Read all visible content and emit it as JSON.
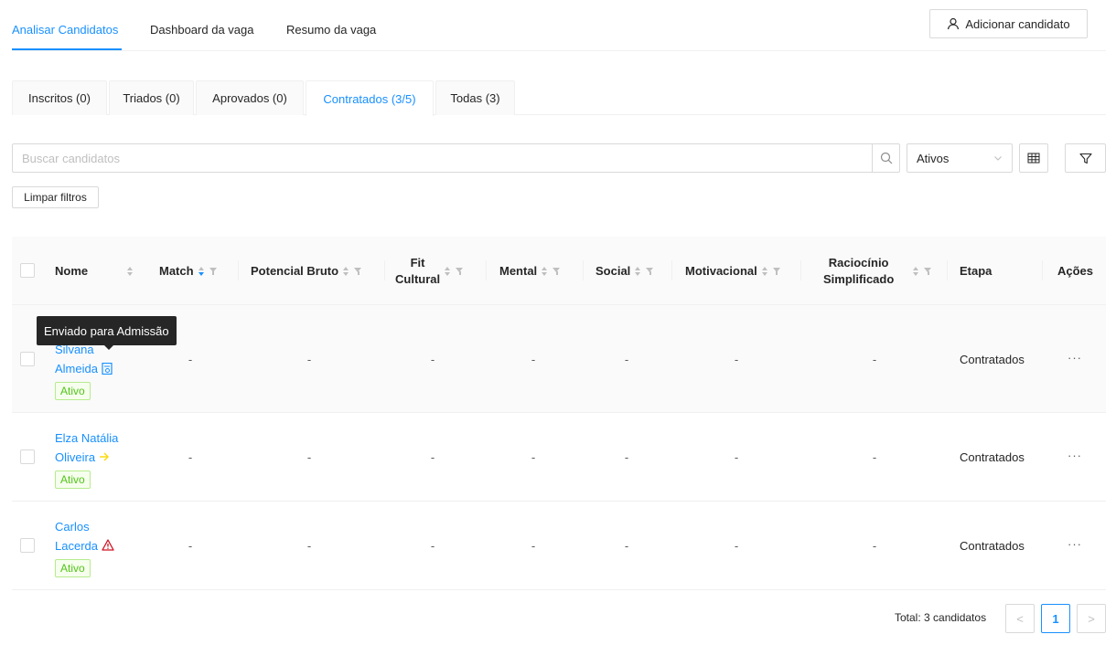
{
  "topnav": {
    "links": [
      {
        "label": "Analisar Candidatos",
        "active": true
      },
      {
        "label": "Dashboard da vaga"
      },
      {
        "label": "Resumo da vaga"
      }
    ],
    "add_button_label": "Adicionar candidato"
  },
  "tabs": [
    {
      "label": "Inscritos (0)"
    },
    {
      "label": "Triados (0)"
    },
    {
      "label": "Aprovados (0)"
    },
    {
      "label": "Contratados (3/5)",
      "active": true
    },
    {
      "label": "Todas (3)"
    }
  ],
  "search": {
    "placeholder": "Buscar candidatos",
    "value": ""
  },
  "status_filter": {
    "selected": "Ativos"
  },
  "clear_filters_label": "Limpar filtros",
  "table": {
    "columns": {
      "nome": "Nome",
      "match": "Match",
      "potencial": "Potencial Bruto",
      "fit_line1": "Fit",
      "fit_line2": "Cultural",
      "mental": "Mental",
      "social": "Social",
      "motivacional": "Motivacional",
      "raciocinio_line1": "Raciocínio",
      "raciocinio_line2": "Simplificado",
      "etapa": "Etapa",
      "acoes": "Ações"
    },
    "rows": [
      {
        "name_line1": "Silvana",
        "name_line2": "Almeida",
        "name_icon": "document-icon",
        "status": "Ativo",
        "match": "-",
        "potencial": "-",
        "fit": "-",
        "mental": "-",
        "social": "-",
        "motivacional": "-",
        "raciocinio": "-",
        "etapa": "Contratados",
        "actions": "···"
      },
      {
        "name_line1": "Elza Natália",
        "name_line2": "Oliveira",
        "name_icon": "arrow-right-icon",
        "status": "Ativo",
        "match": "-",
        "potencial": "-",
        "fit": "-",
        "mental": "-",
        "social": "-",
        "motivacional": "-",
        "raciocinio": "-",
        "etapa": "Contratados",
        "actions": "···"
      },
      {
        "name_line1": "Carlos",
        "name_line2": "Lacerda",
        "name_icon": "warning-icon",
        "status": "Ativo",
        "match": "-",
        "potencial": "-",
        "fit": "-",
        "mental": "-",
        "social": "-",
        "motivacional": "-",
        "raciocinio": "-",
        "etapa": "Contratados",
        "actions": "···"
      }
    ]
  },
  "tooltip": {
    "text": "Enviado para Admissão"
  },
  "pagination": {
    "total_label": "Total: 3 candidatos",
    "current_page": "1",
    "prev": "<",
    "next": ">"
  },
  "colors": {
    "accent": "#1890ff",
    "success": "#52c41a",
    "warning": "#fadb14",
    "danger": "#cf1322"
  }
}
